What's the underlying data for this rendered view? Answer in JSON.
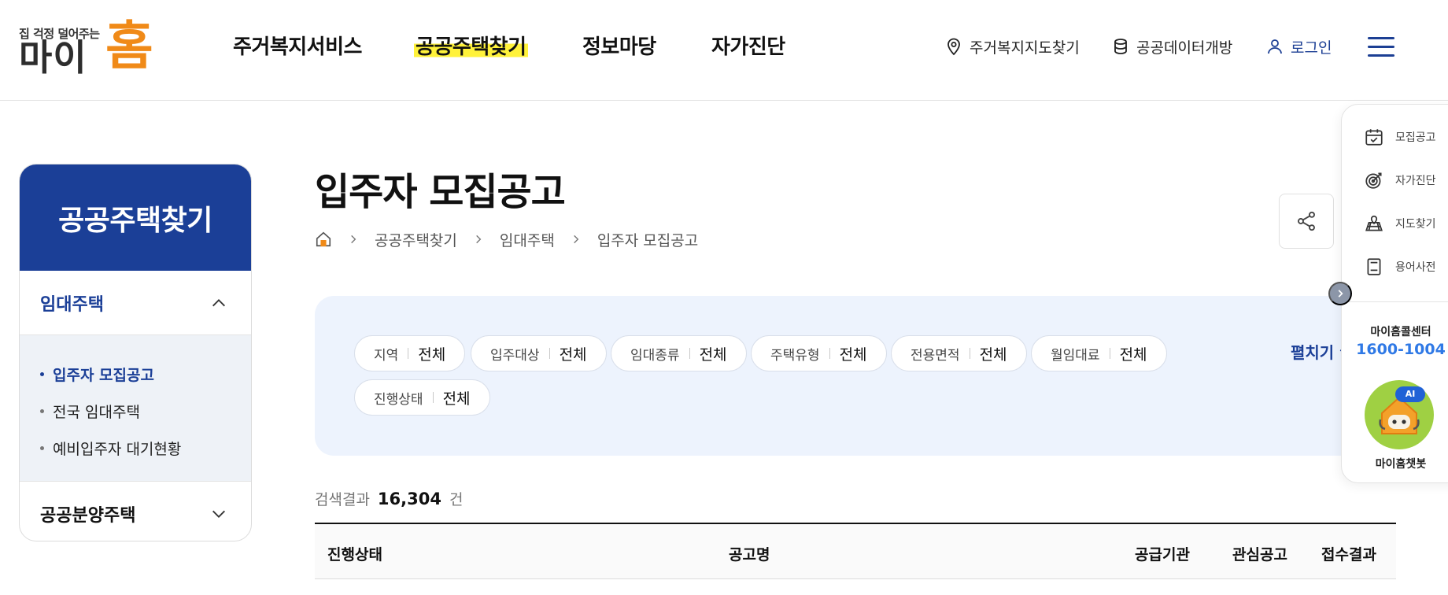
{
  "logo": {
    "tagline": "집 걱정 덜어주는",
    "main": "마이",
    "accent": "홈"
  },
  "gnb": [
    {
      "label": "주거복지서비스"
    },
    {
      "label": "공공주택찾기"
    },
    {
      "label": "정보마당"
    },
    {
      "label": "자가진단"
    }
  ],
  "util": {
    "map": "주거복지지도찾기",
    "data": "공공데이터개방",
    "login": "로그인"
  },
  "lnb": {
    "title": "공공주택찾기",
    "group1": "임대주택",
    "sub": [
      "입주자 모집공고",
      "전국 임대주택",
      "예비입주자 대기현황"
    ],
    "group2": "공공분양주택"
  },
  "page": {
    "title": "입주자 모집공고",
    "breadcrumb": [
      "공공주택찾기",
      "임대주택",
      "입주자 모집공고"
    ]
  },
  "filters": [
    {
      "label": "지역",
      "value": "전체"
    },
    {
      "label": "입주대상",
      "value": "전체"
    },
    {
      "label": "임대종류",
      "value": "전체"
    },
    {
      "label": "주택유형",
      "value": "전체"
    },
    {
      "label": "전용면적",
      "value": "전체"
    },
    {
      "label": "월임대료",
      "value": "전체"
    },
    {
      "label": "진행상태",
      "value": "전체"
    }
  ],
  "expand_label": "펼치기",
  "result": {
    "label": "검색결과",
    "count": "16,304",
    "unit": "건"
  },
  "table": {
    "headers": [
      "진행상태",
      "공고명",
      "공급기관",
      "관심공고",
      "접수결과"
    ]
  },
  "quick": {
    "items": [
      "모집공고",
      "자가진단",
      "지도찾기",
      "용어사전"
    ],
    "call_label": "마이홈콜센터",
    "call_number": "1600-1004",
    "bot_badge": "AI",
    "bot_label": "마이홈챗봇"
  },
  "colors": {
    "brand": "#1b3f97",
    "accent": "#f08a18",
    "highlight": "#fff23a",
    "filter_bg": "#edf3fd",
    "call": "#2f79e6"
  }
}
